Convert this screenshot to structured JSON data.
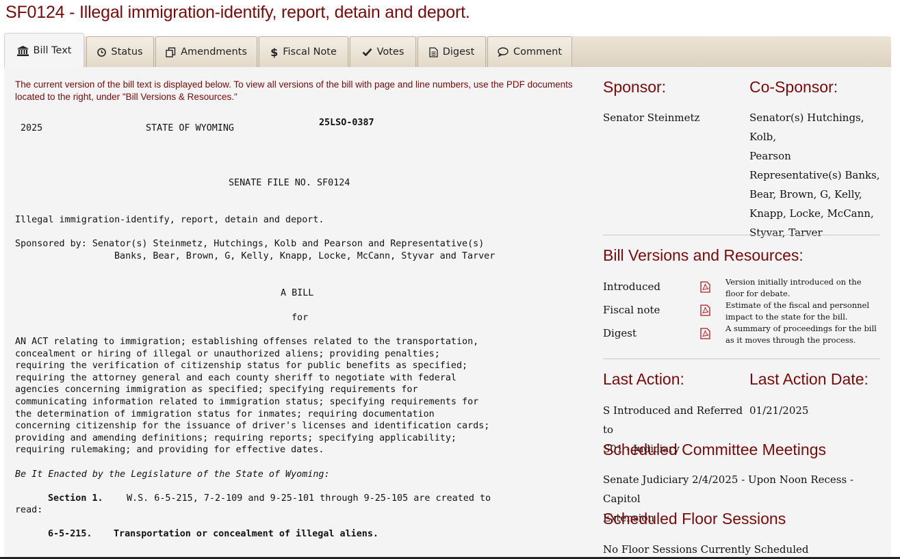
{
  "page_title": "SF0124 - Illegal immigration-identify, report, detain and deport.",
  "tabs": [
    {
      "label": "Bill Text",
      "icon": "bank-icon"
    },
    {
      "label": "Status",
      "icon": "clock-icon"
    },
    {
      "label": "Amendments",
      "icon": "copy-icon"
    },
    {
      "label": "Fiscal Note",
      "icon": "dollar-icon"
    },
    {
      "label": "Votes",
      "icon": "check-icon"
    },
    {
      "label": "Digest",
      "icon": "document-icon"
    },
    {
      "label": "Comment",
      "icon": "comment-icon"
    }
  ],
  "notice": "The current version of the bill text is displayed below. To view all versions of the bill with page and line numbers, use the PDF documents located to the right, under \"Bill Versions & Resources.\"",
  "bill": {
    "year": "2025",
    "state": "STATE OF WYOMING",
    "lso": "25LSO-0387",
    "file_no": "SENATE FILE NO. SF0124",
    "short_title": "Illegal immigration-identify, report, detain and deport.",
    "sponsored_line1": "Sponsored by: Senator(s) Steinmetz, Hutchings, Kolb and Pearson and Representative(s)",
    "sponsored_line2": "Banks, Bear, Brown, G, Kelly, Knapp, Locke, McCann, Styvar and Tarver",
    "a_bill": "A BILL",
    "for": "for",
    "act_lines": [
      "AN ACT relating to immigration; establishing offenses related to the transportation,",
      "concealment or hiring of illegal or unauthorized aliens; providing penalties;",
      "requiring the verification of citizenship status for public benefits as specified;",
      "requiring the attorney general and each county sheriff to negotiate with federal",
      "agencies concerning immigration as specified; specifying requirements for",
      "communicating information related to immigration status; specifying requirements for",
      "the determination of immigration status for inmates; requiring documentation",
      "concerning citizenship for the issuance of driver's licenses and identification cards;",
      "providing and amending definitions; requiring reports; specifying applicability;",
      "requiring rulemaking; and providing for effective dates."
    ],
    "enacted": "Be It Enacted by the Legislature of the State of Wyoming:",
    "section_label": "Section 1.",
    "section_text": "W.S. 6-5-215, 7-2-109 and 9-25-101 through 9-25-105 are created to",
    "section_text2": "read:",
    "subsection_num": "6-5-215.",
    "subsection_title": "Transportation or concealment of illegal aliens."
  },
  "sidebar": {
    "sponsor_heading": "Sponsor:",
    "sponsor_name": "Senator Steinmetz",
    "cosponsor_heading": "Co-Sponsor:",
    "cosponsor_lines": [
      "Senator(s) Hutchings, Kolb,",
      "Pearson",
      "Representative(s) Banks,",
      "Bear, Brown, G, Kelly,",
      "Knapp, Locke, McCann,",
      "Styvar, Tarver"
    ],
    "versions_heading": "Bill Versions and Resources:",
    "resources": [
      {
        "name": "Introduced",
        "desc": "Version initially introduced on the floor for debate.",
        "icon": "pdf-icon"
      },
      {
        "name": "Fiscal note",
        "desc": "Estimate of the fiscal and personnel impact to the state for the bill.",
        "icon": "pdf-icon"
      },
      {
        "name": "Digest",
        "desc": "A summary of proceedings for the bill as it moves through the process.",
        "icon": "pdf-icon"
      }
    ],
    "last_action_heading": "Last Action:",
    "last_action_lines": [
      "S Introduced and Referred to",
      "S01 - Judiciary"
    ],
    "last_action_date_heading": "Last Action Date:",
    "last_action_date": "01/21/2025",
    "committee_heading": "Scheduled Committee Meetings",
    "committee_lines": [
      "Senate Judiciary 2/4/2025 - Upon Noon Recess - Capitol",
      "Extension"
    ],
    "floor_heading": "Scheduled Floor Sessions",
    "floor_text": "No Floor Sessions Currently Scheduled"
  },
  "colors": {
    "accent": "#7a0a0a",
    "tab_bg": "#e3d9c8",
    "content_bg": "#f4f4f4"
  }
}
